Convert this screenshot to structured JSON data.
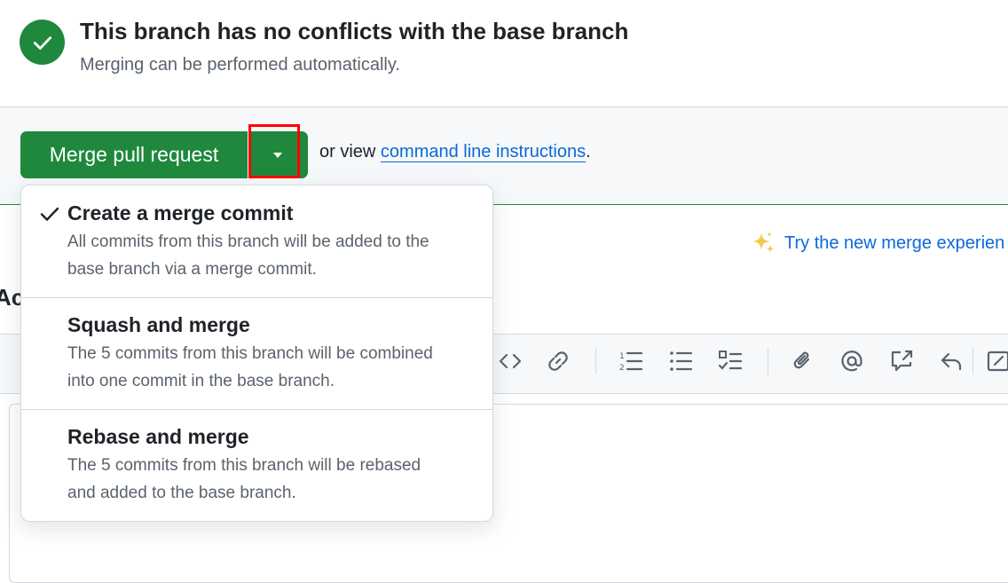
{
  "status": {
    "title": "This branch has no conflicts with the base branch",
    "subtitle": "Merging can be performed automatically.",
    "icon": "check-icon"
  },
  "merge": {
    "button_label": "Merge pull request",
    "or_view_prefix": "or view ",
    "command_link": "command line instructions",
    "suffix": "."
  },
  "try_new": {
    "label": "Try the new merge experien",
    "icon": "sparkles-icon"
  },
  "comment": {
    "heading_fragment": "Ac"
  },
  "dropdown": {
    "options": [
      {
        "title": "Create a merge commit",
        "line1": "All commits from this branch will be added to the",
        "line2": "base branch via a merge commit.",
        "selected": true
      },
      {
        "title": "Squash and merge",
        "line1": "The 5 commits from this branch will be combined",
        "line2": "into one commit in the base branch.",
        "selected": false
      },
      {
        "title": "Rebase and merge",
        "line1": "The 5 commits from this branch will be rebased",
        "line2": "and added to the base branch.",
        "selected": false
      }
    ]
  },
  "toolbar_icons": [
    "code-icon",
    "link-icon",
    "ordered-list-icon",
    "unordered-list-icon",
    "task-list-icon",
    "attach-icon",
    "mention-icon",
    "cross-reference-icon",
    "reply-icon",
    "fullscreen-icon"
  ],
  "colors": {
    "success": "#1f883d",
    "link": "#0969da",
    "highlight": "#ff0000"
  }
}
